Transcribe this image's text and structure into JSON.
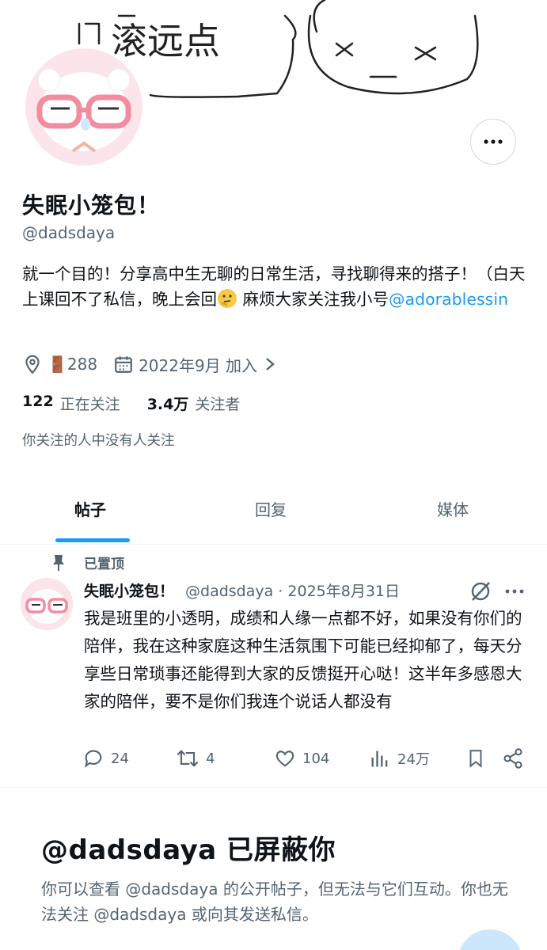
{
  "banner": {
    "text": "滚远点"
  },
  "profile": {
    "display_name": "失眠小笼包！",
    "handle": "@dadsdaya",
    "bio_text": "就一个目的！分享高中生无聊的日常生活，寻找聊得来的搭子！（白天上课回不了私信，晚上会回",
    "bio_text2": " 麻烦大家关注我小号",
    "bio_link": "@adorablessin",
    "location_label": "🚪288",
    "joined_label": "2022年9月 加入",
    "following_count": "122",
    "following_label": "正在关注",
    "followers_count": "3.4万",
    "followers_label": "关注者",
    "followed_by": "你关注的人中没有人关注"
  },
  "tabs": [
    {
      "label": "帖子",
      "active": true
    },
    {
      "label": "回复",
      "active": false
    },
    {
      "label": "媒体",
      "active": false
    }
  ],
  "post": {
    "pinned_label": "已置顶",
    "author_name": "失眠小笼包！",
    "author_handle": "@dadsdaya · 2025年8月31日",
    "text": "我是班里的小透明，成绩和人缘一点都不好，如果没有你们的陪伴，我在这种家庭这种生活氛围下可能已经抑郁了，每天分享些日常琐事还能得到大家的反馈挺开心哒！这半年多感恩大家的陪伴，要不是你们我连个说话人都没有",
    "replies": "24",
    "reposts": "4",
    "likes": "104",
    "views": "24万"
  },
  "blocked": {
    "title": "@dadsdaya 已屏蔽你",
    "description": "你可以查看 @dadsdaya 的公开帖子，但无法与它们互动。你也无法关注 @dadsdaya 或向其发送私信。"
  },
  "colors": {
    "accent": "#1d9bf0",
    "secondary_text": "#536471",
    "border": "#eff3f4"
  },
  "icons": [
    "location-icon",
    "calendar-icon",
    "chevron-right-icon",
    "more-icon",
    "pin-icon",
    "grok-icon",
    "reply-icon",
    "repost-icon",
    "like-icon",
    "views-icon",
    "bookmark-icon",
    "share-icon"
  ]
}
